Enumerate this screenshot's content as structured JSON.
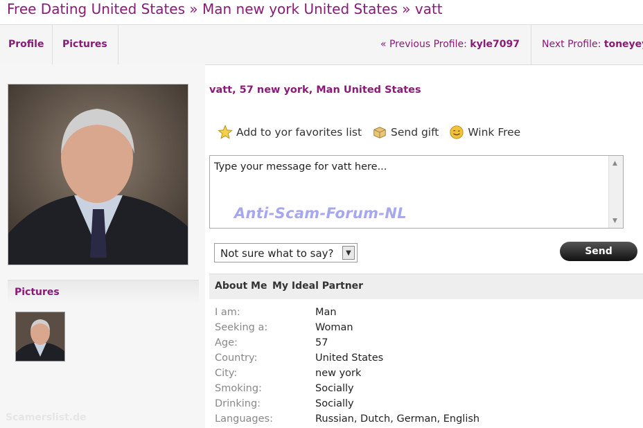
{
  "breadcrumb": {
    "part1": "Free Dating United States",
    "sep": "»",
    "part2": "Man new york United States",
    "part3": "vatt"
  },
  "nav": {
    "tab_profile": "Profile",
    "tab_pictures": "Pictures",
    "prev_prefix": "« Previous Profile:",
    "prev_name": "kyle7097",
    "next_prefix": "Next Profile:",
    "next_name": "toneyey"
  },
  "sidebar": {
    "pictures_label": "Pictures",
    "watermark": "Scamerslist.de"
  },
  "profile": {
    "title": "vatt, 57 new york, Man United States"
  },
  "actions": {
    "favorite": "Add to yor favorites list",
    "gift": "Send gift",
    "wink": "Wink Free"
  },
  "message": {
    "text": "Type your message for vatt here...",
    "watermark": "Anti-Scam-Forum-NL"
  },
  "suggest_select": {
    "value": "Not sure what to say?"
  },
  "send_button": "Send",
  "detail_tabs": {
    "about": "About Me",
    "ideal": "My Ideal Partner"
  },
  "details": [
    {
      "k": "I am:",
      "v": "Man"
    },
    {
      "k": "Seeking a:",
      "v": "Woman"
    },
    {
      "k": "Age:",
      "v": "57"
    },
    {
      "k": "Country:",
      "v": "United States"
    },
    {
      "k": "City:",
      "v": "new york"
    },
    {
      "k": "Smoking:",
      "v": "Socially"
    },
    {
      "k": "Drinking:",
      "v": "Socially"
    },
    {
      "k": "Languages:",
      "v": "Russian, Dutch, German, English"
    }
  ],
  "colors": {
    "accent": "#8a1a78"
  },
  "icons": [
    "star-icon",
    "gift-box-icon",
    "wink-smiley-icon"
  ]
}
